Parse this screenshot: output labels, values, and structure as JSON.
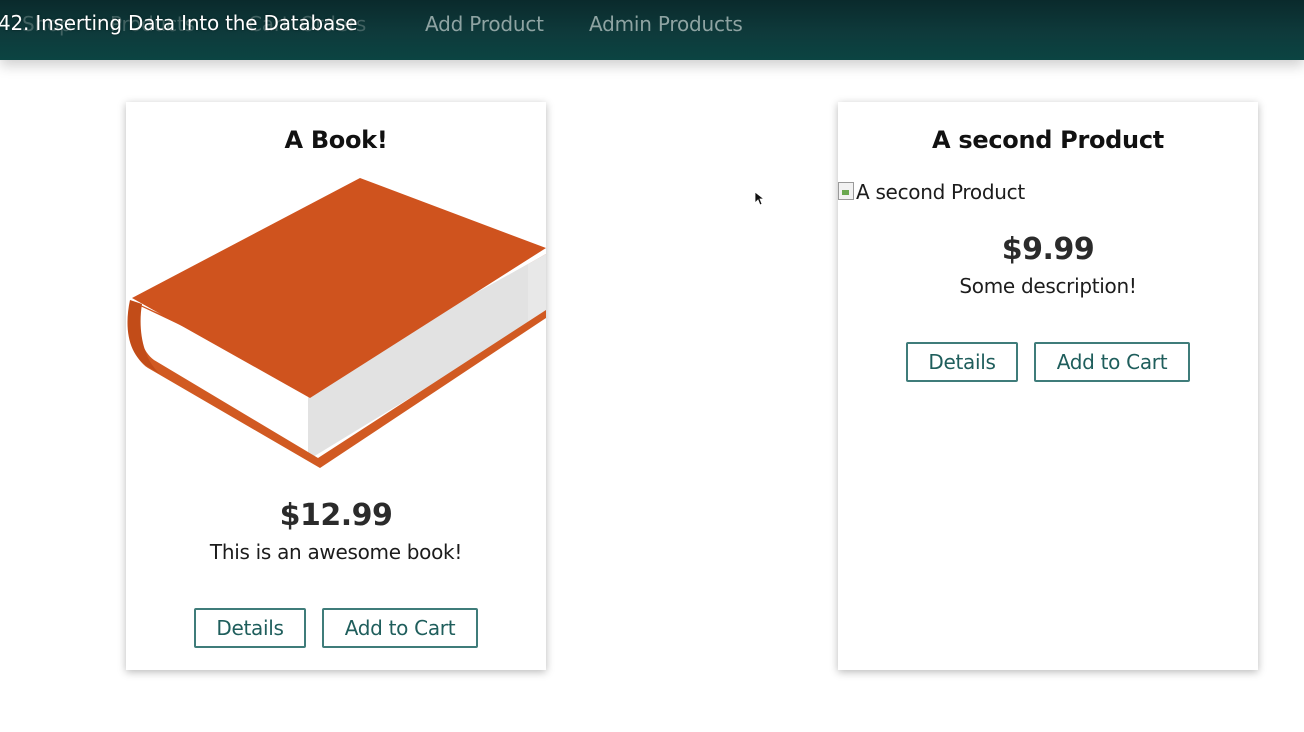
{
  "video_title": "42. Inserting Data Into the Database",
  "nav": {
    "ghost_item_1": "Shop",
    "ghost_item_2": "Products",
    "ghost_item_3": "Cart",
    "ghost_item_4": "Orders",
    "add_product": "Add Product",
    "admin_products": "Admin Products"
  },
  "products": [
    {
      "title": "A Book!",
      "image_alt": "A Book!",
      "price": "$12.99",
      "description": "This is an awesome book!",
      "details_label": "Details",
      "add_to_cart_label": "Add to Cart"
    },
    {
      "title": "A second Product",
      "image_alt": "A second Product",
      "price": "$9.99",
      "description": "Some description!",
      "details_label": "Details",
      "add_to_cart_label": "Add to Cart"
    }
  ],
  "colors": {
    "navbar": "#0e3a3b",
    "book_cover": "#cf531e",
    "button_border": "#3f7c7a",
    "button_text": "#1f5e5c"
  }
}
